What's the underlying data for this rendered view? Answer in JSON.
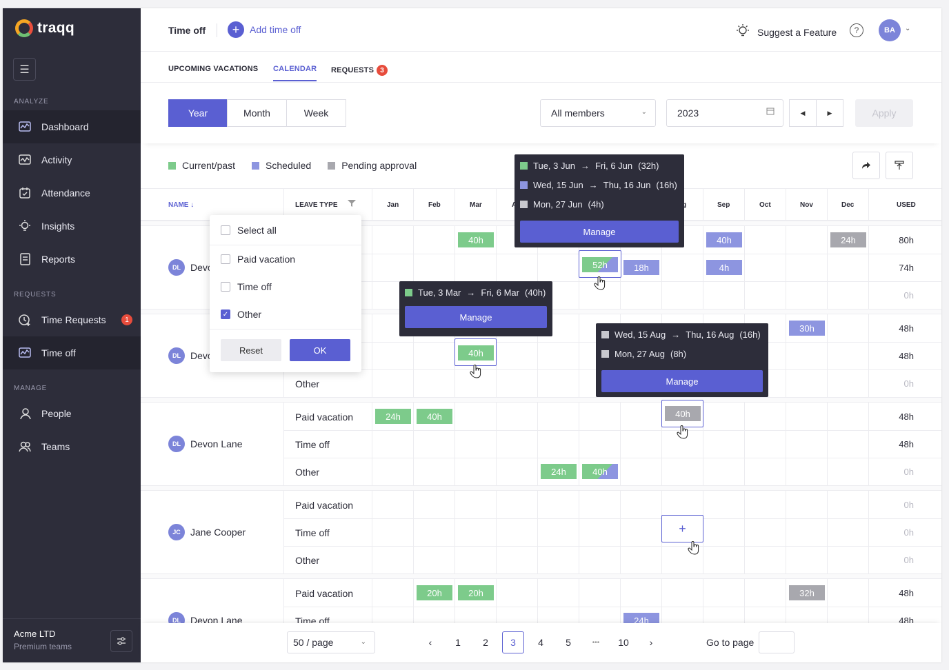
{
  "app": {
    "name": "traqq"
  },
  "sidebar": {
    "sections": {
      "analyze": "ANALYZE",
      "requests": "REQUESTS",
      "manage": "MANAGE"
    },
    "items": [
      {
        "label": "Dashboard",
        "icon": "chart-window-icon"
      },
      {
        "label": "Activity",
        "icon": "activity-icon"
      },
      {
        "label": "Attendance",
        "icon": "calendar-check-icon"
      },
      {
        "label": "Insights",
        "icon": "bulb-icon"
      },
      {
        "label": "Reports",
        "icon": "document-icon"
      },
      {
        "label": "Time Requests",
        "icon": "clock-plus-icon",
        "badge": "1"
      },
      {
        "label": "Time off",
        "icon": "chart-window-icon"
      },
      {
        "label": "People",
        "icon": "person-icon"
      },
      {
        "label": "Teams",
        "icon": "team-icon"
      }
    ],
    "company": {
      "name": "Acme LTD",
      "plan": "Premium teams"
    }
  },
  "header": {
    "title": "Time off",
    "add_label": "Add time off",
    "suggest_label": "Suggest a Feature",
    "help": "?",
    "avatar": "BA"
  },
  "tabs": [
    {
      "label": "UPCOMING VACATIONS"
    },
    {
      "label": "CALENDAR"
    },
    {
      "label": "REQUESTS",
      "badge": "3"
    }
  ],
  "controls": {
    "views": [
      "Year",
      "Month",
      "Week"
    ],
    "members": "All members",
    "year": "2023",
    "apply": "Apply"
  },
  "legend": {
    "items": [
      {
        "label": "Current/past",
        "color": "#7dcb8b"
      },
      {
        "label": "Scheduled",
        "color": "#8d95e0"
      },
      {
        "label": "Pending approval",
        "color": "#a8a8ae"
      }
    ]
  },
  "table": {
    "headers": {
      "name": "NAME",
      "leave_type": "LEAVE TYPE",
      "used": "USED"
    },
    "months": [
      "Jan",
      "Feb",
      "Mar",
      "A",
      "",
      "",
      "",
      "g",
      "Sep",
      "Oct",
      "Nov",
      "Dec"
    ],
    "people": [
      {
        "name": "Devo",
        "initials": "DL",
        "used": [
          "80h",
          "74h",
          "0h"
        ],
        "types": [
          "",
          "",
          ""
        ]
      },
      {
        "name": "Devo",
        "initials": "DL",
        "used": [
          "48h",
          "48h",
          "0h"
        ],
        "types": [
          "",
          "",
          "Other"
        ]
      },
      {
        "name": "Devon Lane",
        "initials": "DL",
        "used": [
          "48h",
          "48h",
          "0h"
        ],
        "types": [
          "Paid vacation",
          "Time off",
          "Other"
        ]
      },
      {
        "name": "Jane Cooper",
        "initials": "JC",
        "used": [
          "0h",
          "0h",
          "0h"
        ],
        "types": [
          "Paid vacation",
          "Time off",
          "Other"
        ]
      },
      {
        "name": "Devon Lane",
        "initials": "DL",
        "used": [
          "48h",
          "48h"
        ],
        "types": [
          "Paid vacation",
          "Time off"
        ]
      }
    ],
    "pills": {
      "r1_mar": "40h",
      "r1_jun": "52h",
      "r1_jul": "18h",
      "r1_sep_a": "40h",
      "r1_sep_b": "4h",
      "r1_dec": "24h",
      "r2_mar": "40h",
      "r2_nov": "30h",
      "r3_jan": "24h",
      "r3_feb": "40h",
      "r3_aug": "40h",
      "r3_may": "24h",
      "r3_jun": "40h",
      "r5_feb": "20h",
      "r5_mar": "20h",
      "r5_nov": "32h",
      "r5_jul": "24h"
    },
    "add_cell": "+"
  },
  "filter_dropdown": {
    "options": [
      {
        "label": "Select all",
        "checked": false
      },
      {
        "label": "Paid vacation",
        "checked": false
      },
      {
        "label": "Time off",
        "checked": false
      },
      {
        "label": "Other",
        "checked": true
      }
    ],
    "reset": "Reset",
    "ok": "OK"
  },
  "popups": {
    "jun": {
      "lines": [
        {
          "from": "Tue, 3 Jun",
          "to": "Fri, 6 Jun",
          "hours": "(32h)",
          "color": "#7dcb8b"
        },
        {
          "from": "Wed, 15 Jun",
          "to": "Thu, 16 Jun",
          "hours": "(16h)",
          "color": "#8d95e0"
        },
        {
          "text": "Mon, 27 Jun",
          "hours": "(4h)",
          "color": "#c8c8ce"
        }
      ],
      "manage": "Manage"
    },
    "mar": {
      "lines": [
        {
          "from": "Tue, 3 Mar",
          "to": "Fri, 6 Mar",
          "hours": "(40h)",
          "color": "#7dcb8b"
        }
      ],
      "manage": "Manage"
    },
    "aug": {
      "lines": [
        {
          "from": "Wed, 15 Aug",
          "to": "Thu, 16 Aug",
          "hours": "(16h)",
          "color": "#c8c8ce"
        },
        {
          "text": "Mon, 27 Aug",
          "hours": "(8h)",
          "color": "#c8c8ce"
        }
      ],
      "manage": "Manage"
    }
  },
  "footer": {
    "per_page": "50 / page",
    "pages": [
      "1",
      "2",
      "3",
      "4",
      "5",
      "•••",
      "10"
    ],
    "current_page": "3",
    "goto": "Go to page"
  }
}
